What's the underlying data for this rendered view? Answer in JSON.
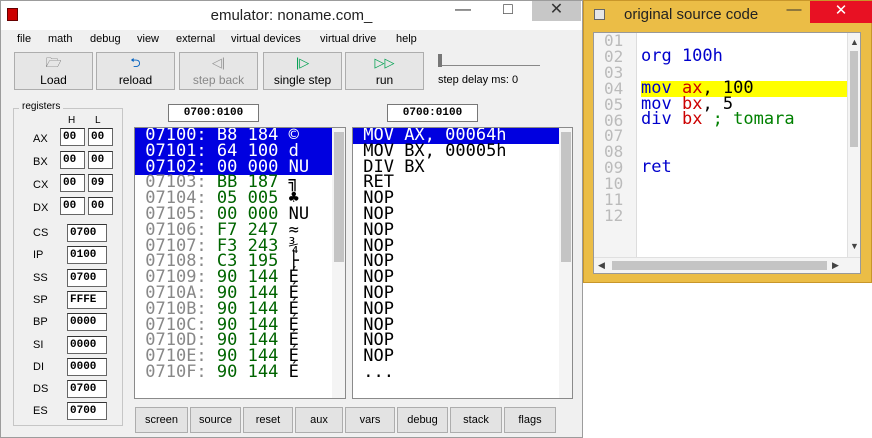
{
  "window": {
    "title": "emulator: noname.com_",
    "controls": [
      "—",
      "□",
      "✕"
    ]
  },
  "menu": [
    "file",
    "math",
    "debug",
    "view",
    "external",
    "virtual devices",
    "virtual drive",
    "help"
  ],
  "toolbar": [
    {
      "label": "Load",
      "icon": "🗁",
      "enabled": true
    },
    {
      "label": "reload",
      "icon": "⮌",
      "enabled": true
    },
    {
      "label": "step back",
      "icon": "◁|",
      "enabled": false
    },
    {
      "label": "single step",
      "icon": "|▷",
      "enabled": true
    },
    {
      "label": "run",
      "icon": "▷▷",
      "enabled": true
    }
  ],
  "step_delay": {
    "label": "step delay ms: 0",
    "value": 0
  },
  "registers": {
    "title": "registers",
    "high_label": "H",
    "low_label": "L",
    "split": [
      {
        "name": "AX",
        "h": "00",
        "l": "00"
      },
      {
        "name": "BX",
        "h": "00",
        "l": "00"
      },
      {
        "name": "CX",
        "h": "00",
        "l": "09"
      },
      {
        "name": "DX",
        "h": "00",
        "l": "00"
      }
    ],
    "full": [
      {
        "name": "CS",
        "value": "0700"
      },
      {
        "name": "IP",
        "value": "0100"
      },
      {
        "name": "SS",
        "value": "0700"
      },
      {
        "name": "SP",
        "value": "FFFE"
      },
      {
        "name": "BP",
        "value": "0000"
      },
      {
        "name": "SI",
        "value": "0000"
      },
      {
        "name": "DI",
        "value": "0000"
      },
      {
        "name": "DS",
        "value": "0700"
      },
      {
        "name": "ES",
        "value": "0700"
      }
    ]
  },
  "memory_address": "0700:0100",
  "disasm_address": "0700:0100",
  "memory": [
    {
      "addr": "07100:",
      "hex": "B8",
      "dec": "184",
      "ch": "©",
      "sel": true
    },
    {
      "addr": "07101:",
      "hex": "64",
      "dec": "100",
      "ch": "d",
      "sel": true
    },
    {
      "addr": "07102:",
      "hex": "00",
      "dec": "000",
      "ch": "NU",
      "sel": true
    },
    {
      "addr": "07103:",
      "hex": "BB",
      "dec": "187",
      "ch": "╗",
      "sel": false
    },
    {
      "addr": "07104:",
      "hex": "05",
      "dec": "005",
      "ch": "♣",
      "sel": false
    },
    {
      "addr": "07105:",
      "hex": "00",
      "dec": "000",
      "ch": "NU",
      "sel": false
    },
    {
      "addr": "07106:",
      "hex": "F7",
      "dec": "247",
      "ch": "≈",
      "sel": false
    },
    {
      "addr": "07107:",
      "hex": "F3",
      "dec": "243",
      "ch": "¾",
      "sel": false
    },
    {
      "addr": "07108:",
      "hex": "C3",
      "dec": "195",
      "ch": "├",
      "sel": false
    },
    {
      "addr": "07109:",
      "hex": "90",
      "dec": "144",
      "ch": "É",
      "sel": false
    },
    {
      "addr": "0710A:",
      "hex": "90",
      "dec": "144",
      "ch": "É",
      "sel": false
    },
    {
      "addr": "0710B:",
      "hex": "90",
      "dec": "144",
      "ch": "É",
      "sel": false
    },
    {
      "addr": "0710C:",
      "hex": "90",
      "dec": "144",
      "ch": "É",
      "sel": false
    },
    {
      "addr": "0710D:",
      "hex": "90",
      "dec": "144",
      "ch": "É",
      "sel": false
    },
    {
      "addr": "0710E:",
      "hex": "90",
      "dec": "144",
      "ch": "É",
      "sel": false
    },
    {
      "addr": "0710F:",
      "hex": "90",
      "dec": "144",
      "ch": "É",
      "sel": false
    }
  ],
  "disasm": [
    {
      "text": "MOV AX, 00064h",
      "sel": true
    },
    {
      "text": "MOV BX, 00005h",
      "sel": false
    },
    {
      "text": "DIV BX",
      "sel": false
    },
    {
      "text": "RET",
      "sel": false
    },
    {
      "text": "NOP",
      "sel": false
    },
    {
      "text": "NOP",
      "sel": false
    },
    {
      "text": "NOP",
      "sel": false
    },
    {
      "text": "NOP",
      "sel": false
    },
    {
      "text": "NOP",
      "sel": false
    },
    {
      "text": "NOP",
      "sel": false
    },
    {
      "text": "NOP",
      "sel": false
    },
    {
      "text": "NOP",
      "sel": false
    },
    {
      "text": "NOP",
      "sel": false
    },
    {
      "text": "NOP",
      "sel": false
    },
    {
      "text": "NOP",
      "sel": false
    },
    {
      "text": "...",
      "sel": false
    }
  ],
  "bottom_buttons": [
    "screen",
    "source",
    "reset",
    "aux",
    "vars",
    "debug",
    "stack",
    "flags"
  ],
  "source_window": {
    "title": "original source code",
    "close": "✕",
    "min": "—",
    "line_numbers": [
      "01",
      "02",
      "03",
      "04",
      "05",
      "06",
      "07",
      "08",
      "09",
      "10",
      "11",
      "12"
    ],
    "lines": [
      {
        "tokens": [],
        "hi": false
      },
      {
        "tokens": [
          {
            "t": "org 100h",
            "c": "kw"
          }
        ],
        "hi": false
      },
      {
        "tokens": [],
        "hi": false
      },
      {
        "tokens": [
          {
            "t": "mov ",
            "c": "kw"
          },
          {
            "t": "ax",
            "c": "reg"
          },
          {
            "t": ", 100",
            "c": "num"
          }
        ],
        "hi": true
      },
      {
        "tokens": [
          {
            "t": "mov ",
            "c": "kw"
          },
          {
            "t": "bx",
            "c": "reg"
          },
          {
            "t": ", 5",
            "c": "num"
          }
        ],
        "hi": false
      },
      {
        "tokens": [
          {
            "t": "div ",
            "c": "kw"
          },
          {
            "t": "bx",
            "c": "reg"
          },
          {
            "t": " ; tomara",
            "c": "cm"
          }
        ],
        "hi": false
      },
      {
        "tokens": [],
        "hi": false
      },
      {
        "tokens": [],
        "hi": false
      },
      {
        "tokens": [
          {
            "t": "ret",
            "c": "kw"
          }
        ],
        "hi": false
      },
      {
        "tokens": [],
        "hi": false
      },
      {
        "tokens": [],
        "hi": false
      },
      {
        "tokens": [],
        "hi": false
      }
    ]
  }
}
